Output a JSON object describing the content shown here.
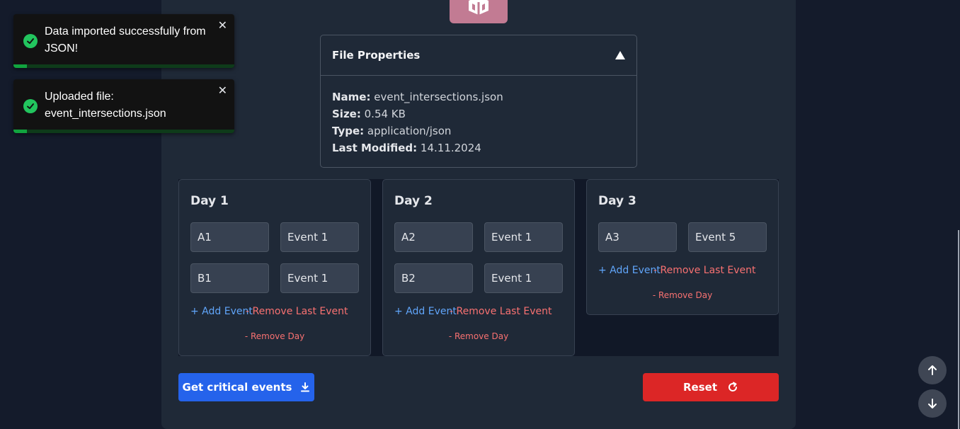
{
  "toasts": [
    {
      "message": "Data imported successfully from JSON!",
      "close": "✕",
      "progress": 0.06,
      "accent": "#22c55e"
    },
    {
      "message": "Uploaded file: event_intersections.json",
      "close": "✕",
      "progress": 0.06,
      "accent": "#22c55e"
    }
  ],
  "file_properties": {
    "title": "File Properties",
    "name_label": "Name:",
    "name_value": "event_intersections.json",
    "size_label": "Size:",
    "size_value": "0.54 KB",
    "type_label": "Type:",
    "type_value": "application/json",
    "modified_label": "Last Modified:",
    "modified_value": "14.11.2024"
  },
  "days": [
    {
      "title": "Day 1",
      "rows": [
        [
          "A1",
          "Event 1"
        ],
        [
          "B1",
          "Event 1"
        ]
      ],
      "add": "+ Add Event",
      "remove_last": "- Remove Last Event",
      "remove_day": "- Remove Day"
    },
    {
      "title": "Day 2",
      "rows": [
        [
          "A2",
          "Event 1"
        ],
        [
          "B2",
          "Event 1"
        ]
      ],
      "add": "+ Add Event",
      "remove_last": "- Remove Last Event",
      "remove_day": "- Remove Day"
    },
    {
      "title": "Day 3",
      "rows": [
        [
          "A3",
          "Event 5"
        ]
      ],
      "add": "+ Add Event",
      "remove_last": "- Remove Last Event",
      "remove_day": "- Remove Day"
    }
  ],
  "actions": {
    "critical_label": "Get critical events",
    "reset_label": "Reset"
  },
  "colors": {
    "primary": "#2563eb",
    "danger": "#dc2626",
    "logo": "#c27b93"
  }
}
